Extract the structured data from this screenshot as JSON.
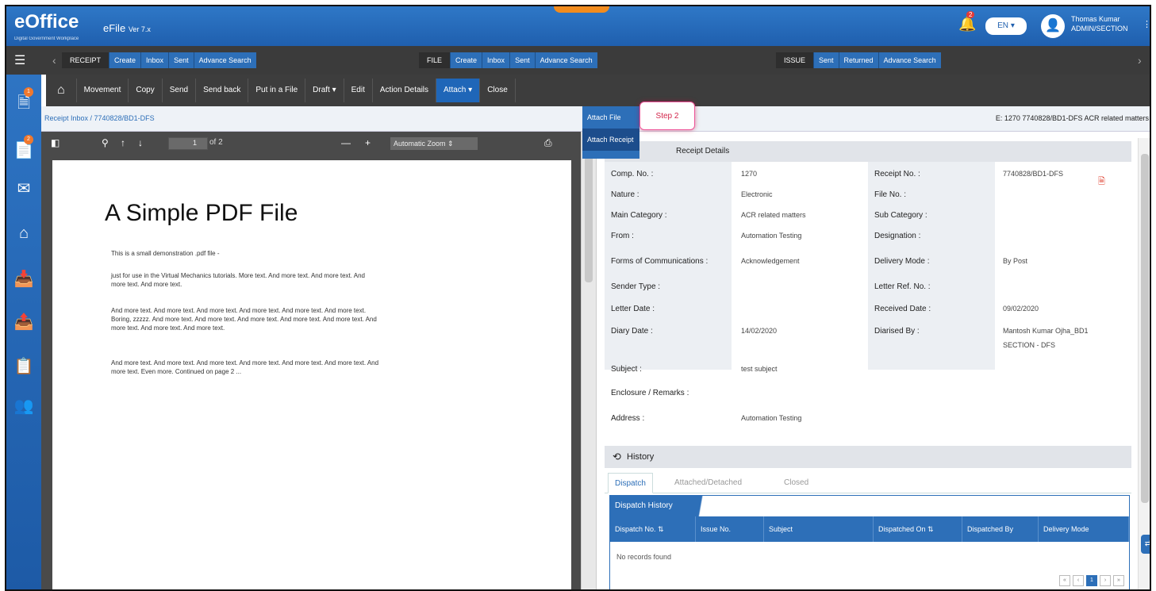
{
  "app": {
    "logo": "eOffice",
    "module": "eFile",
    "version": "Ver 7.x",
    "tagline": "Digital Government Workplace"
  },
  "header": {
    "notif_count": "2",
    "lang": "EN",
    "user_name": "Thomas Kumar",
    "user_role": "ADMIN/SECTION"
  },
  "nav": {
    "receipt": {
      "label": "RECEIPT",
      "items": [
        "Create",
        "Inbox",
        "Sent",
        "Advance Search"
      ]
    },
    "file": {
      "label": "FILE",
      "items": [
        "Create",
        "Inbox",
        "Sent",
        "Advance Search"
      ]
    },
    "issue": {
      "label": "ISSUE",
      "items": [
        "Sent",
        "Returned",
        "Advance Search"
      ]
    }
  },
  "toolbar": {
    "items": [
      "Movement",
      "Copy",
      "Send",
      "Send back",
      "Put in a File",
      "Draft",
      "Edit",
      "Action Details",
      "Attach",
      "Close"
    ],
    "attach_caret": "▾",
    "draft_caret": "▾"
  },
  "attach_menu": {
    "items": [
      "Attach File",
      "Attach Receipt"
    ]
  },
  "step_callout": "Step 2",
  "breadcrumb": "Receipt Inbox / 7740828/BD1-DFS",
  "file_info": "E: 1270  7740828/BD1-DFS  ACR related matters",
  "pdf": {
    "page": "1",
    "of": "of 2",
    "zoom": "Automatic Zoom",
    "title": "A Simple PDF File",
    "p1": "This is a small demonstration .pdf file -",
    "p2": "just for use in the Virtual Mechanics tutorials. More text. And more text. And more text. And more text. And more text.",
    "p3": "And more text. And more text. And more text. And more text. And more text. And more text. Boring, zzzzz. And more text. And more text. And more text. And more text. And more text. And more text. And more text. And more text.",
    "p4": "And more text. And more text. And more text. And more text. And more text. And more text. And more text. Even more. Continued on page 2 ..."
  },
  "details": {
    "header": "Receipt Details",
    "rows": [
      {
        "l1": "Comp. No. :",
        "v1": "1270",
        "l2": "Receipt No. :",
        "v2": "7740828/BD1-DFS"
      },
      {
        "l1": "Nature :",
        "v1": "Electronic",
        "l2": "File No. :",
        "v2": ""
      },
      {
        "l1": "Main Category :",
        "v1": "ACR related matters",
        "l2": "Sub Category :",
        "v2": ""
      },
      {
        "l1": "From :",
        "v1": "Automation Testing",
        "l2": "Designation :",
        "v2": ""
      },
      {
        "l1": "Forms of Communications :",
        "v1": "Acknowledgement",
        "l2": "Delivery Mode :",
        "v2": "By Post"
      },
      {
        "l1": "Sender Type :",
        "v1": "",
        "l2": "Letter Ref. No. :",
        "v2": ""
      },
      {
        "l1": "Letter Date :",
        "v1": "",
        "l2": "Received Date :",
        "v2": "09/02/2020"
      },
      {
        "l1": "Diary Date :",
        "v1": "14/02/2020",
        "l2": "Diarised By :",
        "v2": "Mantosh Kumar Ojha_BD1"
      },
      {
        "l1": "Subject :",
        "v1": "test subject",
        "l2": "",
        "v2": ""
      },
      {
        "l1": "Enclosure / Remarks :",
        "v1": "",
        "l2": "",
        "v2": ""
      },
      {
        "l1": "Address :",
        "v1": "Automation Testing",
        "l2": "",
        "v2": ""
      }
    ],
    "diarised_extra": "SECTION - DFS"
  },
  "history": {
    "title": "History",
    "tabs": [
      "Dispatch",
      "Attached/Detached",
      "Closed"
    ],
    "dispatch_title": "Dispatch History",
    "columns": [
      "Dispatch No. ⇅",
      "Issue No.",
      "Subject",
      "Dispatched On ⇅",
      "Dispatched By",
      "Delivery Mode"
    ],
    "empty": "No records found"
  }
}
